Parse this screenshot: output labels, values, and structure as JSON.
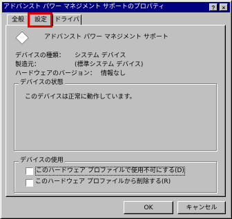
{
  "window": {
    "title": "アドバンスト パワー マネジメント サポートのプロパティ",
    "help_label": "?",
    "close_label": "×"
  },
  "tabs": [
    {
      "label": "全般"
    },
    {
      "label": "設定"
    },
    {
      "label": "ドライバ"
    }
  ],
  "device": {
    "name": "アドバンスト パワー マネジメント サポート",
    "icon": "diamond-device-icon",
    "type_label": "デバイスの種類：",
    "type_value": "システム デバイス",
    "mfr_label": "製造元：",
    "mfr_value": "(標準システム デバイス)",
    "hwver_label": "ハードウェアのバージョン：",
    "hwver_value": "情報なし"
  },
  "status": {
    "legend": "デバイスの状態",
    "text": "このデバイスは正常に動作しています。"
  },
  "usage": {
    "legend": "デバイスの使用",
    "option1": "このハードウェア プロファイルで使用不可にする(D)",
    "option2": "このハードウェア プロファイルから削除する(R)"
  },
  "buttons": {
    "ok": "OK",
    "cancel": "キャンセル"
  },
  "colors": {
    "highlight": "#e00000",
    "titlebar": "#000080"
  }
}
